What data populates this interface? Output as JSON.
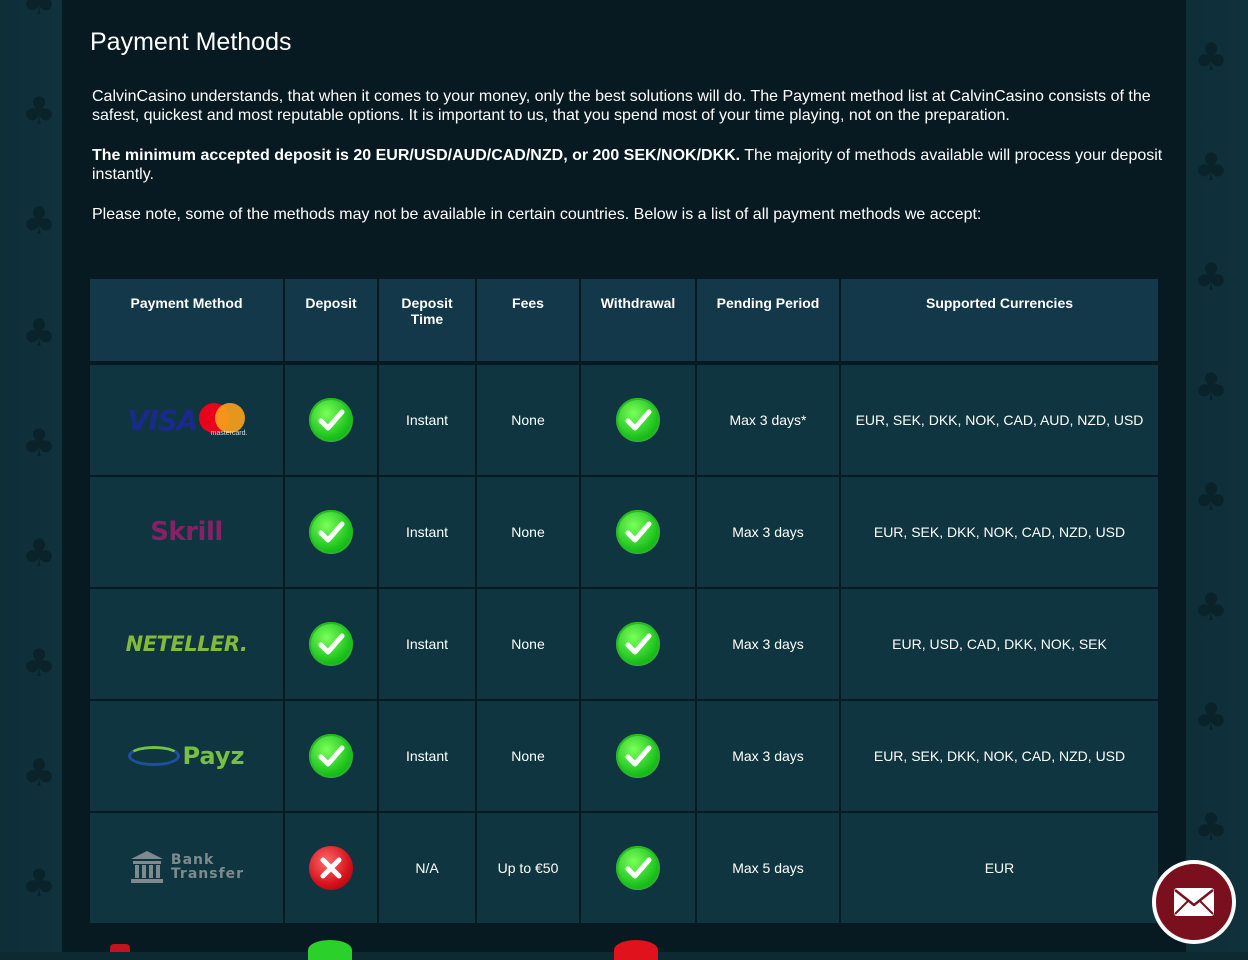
{
  "page": {
    "title": "Payment Methods",
    "intro_p1": "CalvinCasino understands, that when it comes to your money, only the best solutions will do. The Payment method list at CalvinCasino consists of the safest, quickest and most reputable options. It is important to us, that you spend most of your time playing, not on the preparation.",
    "intro_p2_bold": "The minimum accepted deposit is 20 EUR/USD/AUD/CAD/NZD, or 200 SEK/NOK/DKK.",
    "intro_p2_rest": " The majority of methods available will process your deposit instantly.",
    "intro_p3": "Please note, some of the methods may not be available in certain countries. Below is a list of all payment methods we accept:"
  },
  "table": {
    "headers": [
      "Payment Method",
      "Deposit",
      "Deposit Time",
      "Fees",
      "Withdrawal",
      "Pending Period",
      "Supported Currencies"
    ],
    "rows": [
      {
        "logo": "visa-mastercard",
        "logo_text": "VISA",
        "logo_sub": "mastercard.",
        "deposit": true,
        "deposit_time": "Instant",
        "fees": "None",
        "withdrawal": true,
        "pending": "Max 3 days*",
        "currencies": "EUR, SEK, DKK, NOK, CAD, AUD, NZD, USD"
      },
      {
        "logo": "skrill",
        "logo_text": "Skrill",
        "deposit": true,
        "deposit_time": "Instant",
        "fees": "None",
        "withdrawal": true,
        "pending": "Max 3 days",
        "currencies": "EUR, SEK, DKK, NOK, CAD, NZD, USD"
      },
      {
        "logo": "neteller",
        "logo_text": "NETELLER.",
        "deposit": true,
        "deposit_time": "Instant",
        "fees": "None",
        "withdrawal": true,
        "pending": "Max 3 days",
        "currencies": "EUR, USD, CAD, DKK, NOK, SEK"
      },
      {
        "logo": "payz",
        "logo_text": "Payz",
        "deposit": true,
        "deposit_time": "Instant",
        "fees": "None",
        "withdrawal": true,
        "pending": "Max 3 days",
        "currencies": "EUR, SEK, DKK, NOK, CAD, NZD, USD"
      },
      {
        "logo": "bank-transfer",
        "logo_text_1": "Bank",
        "logo_text_2": "Transfer",
        "deposit": false,
        "deposit_time": "N/A",
        "fees": "Up to €50",
        "withdrawal": true,
        "pending": "Max 5 days",
        "currencies": "EUR"
      }
    ]
  },
  "icons": {
    "check": "check-circle-icon",
    "cross": "cross-circle-icon",
    "mail": "mail-icon"
  },
  "colors": {
    "panel": "#071a21",
    "table_bg": "#0f3541",
    "check_green": "#1ec41e",
    "cross_red": "#d5101a",
    "mail_button": "#7a0f1e"
  }
}
